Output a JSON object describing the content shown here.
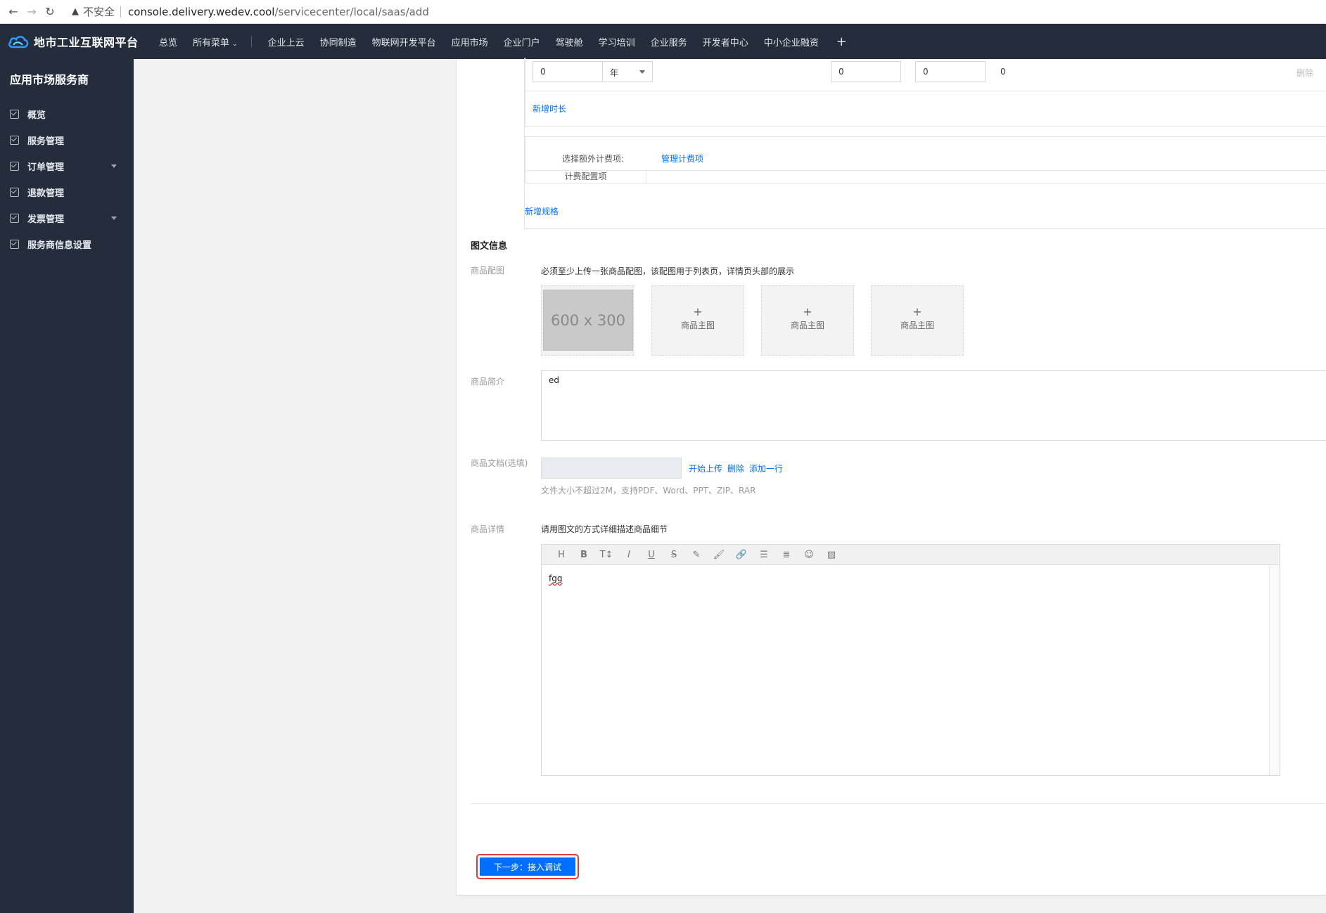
{
  "browser": {
    "insecure_label": "不安全",
    "url_host": "console.delivery.wedev.cool",
    "url_path": "/servicecenter/local/saas/add"
  },
  "topnav": {
    "brand": "地市工业互联网平台",
    "items": [
      "总览",
      "所有菜单",
      "企业上云",
      "协同制造",
      "物联网开发平台",
      "应用市场",
      "企业门户",
      "驾驶舱",
      "学习培训",
      "企业服务",
      "开发者中心",
      "中小企业融资"
    ],
    "plus": "+"
  },
  "sidebar": {
    "title": "应用市场服务商",
    "items": [
      {
        "label": "概览",
        "has_caret": false
      },
      {
        "label": "服务管理",
        "has_caret": false
      },
      {
        "label": "订单管理",
        "has_caret": true
      },
      {
        "label": "退款管理",
        "has_caret": false
      },
      {
        "label": "发票管理",
        "has_caret": true
      },
      {
        "label": "服务商信息设置",
        "has_caret": false
      }
    ]
  },
  "spec": {
    "duration_value": "0",
    "duration_unit": "年",
    "price1": "0",
    "price2": "0",
    "price3": "0",
    "delete_label": "删除",
    "add_duration": "新增时长",
    "extra_label": "选择额外计费项:",
    "manage_fees": "管理计费项",
    "fee_config": "计费配置项",
    "add_spec": "新增规格"
  },
  "media": {
    "section_title": "图文信息",
    "image_label": "商品配图",
    "image_hint": "必须至少上传一张商品配图，该配图用于列表页，详情页头部的展示",
    "placeholder_text": "600 x 300",
    "slot_plus": "+",
    "slot_label": "商品主图",
    "intro_label": "商品简介",
    "intro_value": "ed",
    "doc_label": "商品文档(选填)",
    "upload": "开始上传",
    "delete": "删除",
    "add_row": "添加一行",
    "doc_hint": "文件大小不超过2M，支持PDF、Word、PPT、ZIP、RAR",
    "detail_label": "商品详情",
    "detail_hint": "请用图文的方式详细描述商品细节",
    "editor_value": "fgg",
    "toolbar": [
      "H",
      "B",
      "T↕",
      "I",
      "U",
      "S",
      "✎",
      "🖌",
      "🔗",
      "☰",
      "≣",
      "☺",
      "▨"
    ]
  },
  "actions": {
    "next_label": "下一步：接入调试"
  }
}
